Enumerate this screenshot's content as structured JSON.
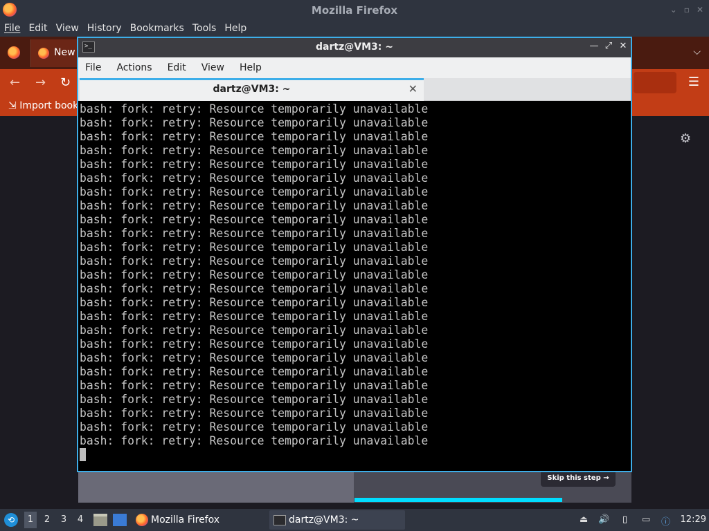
{
  "firefox": {
    "window_title": "Mozilla Firefox",
    "menu": [
      "File",
      "Edit",
      "View",
      "History",
      "Bookmarks",
      "Tools",
      "Help"
    ],
    "tab_label": "New",
    "bookmark_import_label": "Import book",
    "skip_label": "Skip this step",
    "skip_arrow": "→",
    "progress_fraction": 0.6,
    "accent_color": "#c23d16"
  },
  "terminal": {
    "window_title": "dartz@VM3: ~",
    "menu": [
      "File",
      "Actions",
      "Edit",
      "View",
      "Help"
    ],
    "tab_label": "dartz@VM3: ~",
    "tab_close_glyph": "✕",
    "lines": [
      "bash: fork: retry: Resource temporarily unavailable",
      "bash: fork: retry: Resource temporarily unavailable",
      "bash: fork: retry: Resource temporarily unavailable",
      "bash: fork: retry: Resource temporarily unavailable",
      "bash: fork: retry: Resource temporarily unavailable",
      "bash: fork: retry: Resource temporarily unavailable",
      "bash: fork: retry: Resource temporarily unavailable",
      "bash: fork: retry: Resource temporarily unavailable",
      "bash: fork: retry: Resource temporarily unavailable",
      "bash: fork: retry: Resource temporarily unavailable",
      "bash: fork: retry: Resource temporarily unavailable",
      "bash: fork: retry: Resource temporarily unavailable",
      "bash: fork: retry: Resource temporarily unavailable",
      "bash: fork: retry: Resource temporarily unavailable",
      "bash: fork: retry: Resource temporarily unavailable",
      "bash: fork: retry: Resource temporarily unavailable",
      "bash: fork: retry: Resource temporarily unavailable",
      "bash: fork: retry: Resource temporarily unavailable",
      "bash: fork: retry: Resource temporarily unavailable",
      "bash: fork: retry: Resource temporarily unavailable",
      "bash: fork: retry: Resource temporarily unavailable",
      "bash: fork: retry: Resource temporarily unavailable",
      "bash: fork: retry: Resource temporarily unavailable",
      "bash: fork: retry: Resource temporarily unavailable",
      "bash: fork: retry: Resource temporarily unavailable"
    ],
    "accent_color": "#3daee9"
  },
  "taskbar": {
    "workspaces": [
      "1",
      "2",
      "3",
      "4"
    ],
    "active_workspace": "1",
    "tasks": [
      {
        "label": "Mozilla Firefox",
        "icon": "firefox-icon"
      },
      {
        "label": "dartz@VM3: ~",
        "icon": "terminal-icon"
      }
    ],
    "clock": "12:29"
  }
}
